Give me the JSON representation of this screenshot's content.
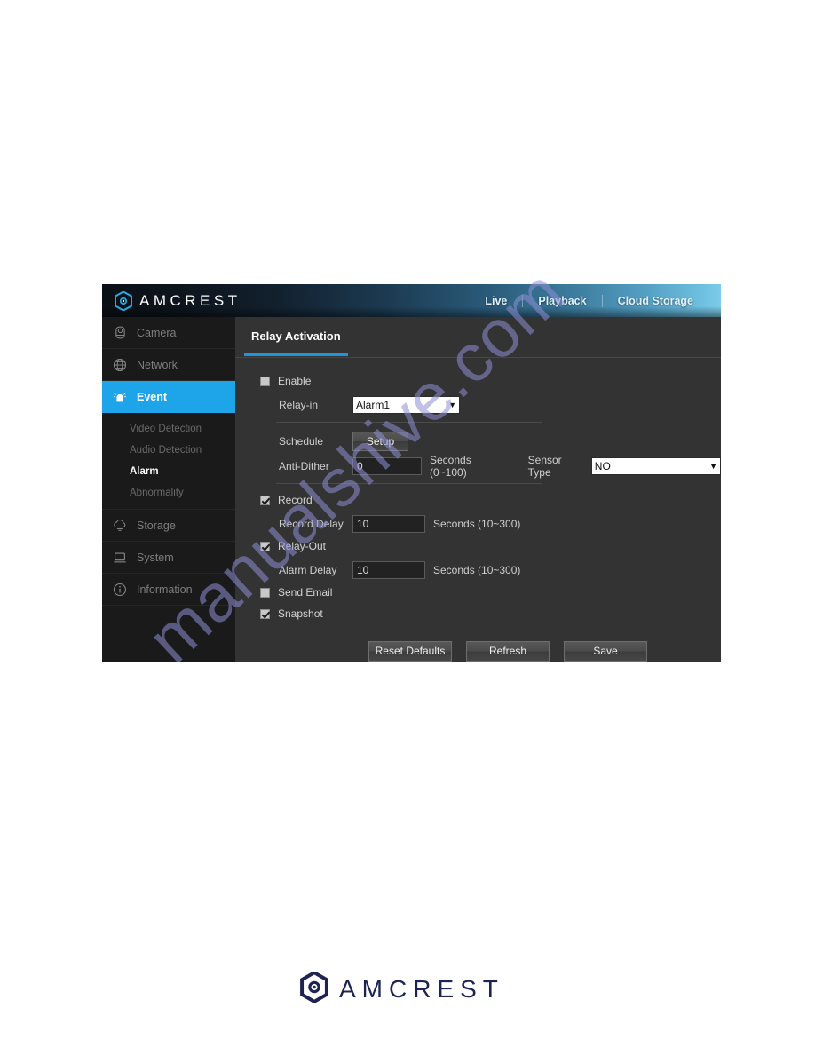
{
  "page": {
    "watermark": "manualshive.com"
  },
  "header": {
    "brand": "AMCREST",
    "brand_icon": "amcrest-hex-logo-icon",
    "nav": [
      {
        "label": "Live"
      },
      {
        "label": "Playback"
      },
      {
        "label": "Cloud Storage"
      }
    ]
  },
  "sidebar": {
    "items": [
      {
        "label": "Camera",
        "icon": "camera-icon",
        "active": false
      },
      {
        "label": "Network",
        "icon": "network-globe-icon",
        "active": false
      },
      {
        "label": "Event",
        "icon": "alarm-bell-icon",
        "active": true
      },
      {
        "label": "Storage",
        "icon": "cloud-icon",
        "active": false
      },
      {
        "label": "System",
        "icon": "monitor-icon",
        "active": false
      },
      {
        "label": "Information",
        "icon": "info-circle-icon",
        "active": false
      }
    ],
    "sub_items": [
      {
        "label": "Video Detection",
        "active": false
      },
      {
        "label": "Audio Detection",
        "active": false
      },
      {
        "label": "Alarm",
        "active": true
      },
      {
        "label": "Abnormality",
        "active": false
      }
    ]
  },
  "main": {
    "tab_label": "Relay Activation",
    "enable": {
      "label": "Enable",
      "checked": false
    },
    "relay_in": {
      "label": "Relay-in",
      "value": "Alarm1",
      "caret": "▼"
    },
    "schedule": {
      "label": "Schedule",
      "button": "Setup"
    },
    "anti_dither": {
      "label": "Anti-Dither",
      "value": "0",
      "hint": "Seconds (0~100)"
    },
    "sensor_type": {
      "label": "Sensor Type",
      "value": "NO",
      "caret": "▼"
    },
    "record": {
      "label": "Record",
      "checked": true
    },
    "record_delay": {
      "label": "Record Delay",
      "value": "10",
      "hint": "Seconds (10~300)"
    },
    "relay_out": {
      "label": "Relay-Out",
      "checked": true
    },
    "alarm_delay": {
      "label": "Alarm Delay",
      "value": "10",
      "hint": "Seconds (10~300)"
    },
    "send_email": {
      "label": "Send Email",
      "checked": false
    },
    "snapshot": {
      "label": "Snapshot",
      "checked": true
    },
    "buttons": [
      {
        "label": "Reset Defaults"
      },
      {
        "label": "Refresh"
      },
      {
        "label": "Save"
      }
    ]
  },
  "footer": {
    "brand": "AMCREST",
    "brand_icon": "amcrest-hex-logo-icon"
  },
  "colors": {
    "accent": "#1ea4e8",
    "tab_underline": "#2196d6",
    "panel_bg": "#333333",
    "sidebar_bg": "#1a1a1a",
    "watermark": "#8f8fd6",
    "footer_logo": "#1d2352"
  }
}
